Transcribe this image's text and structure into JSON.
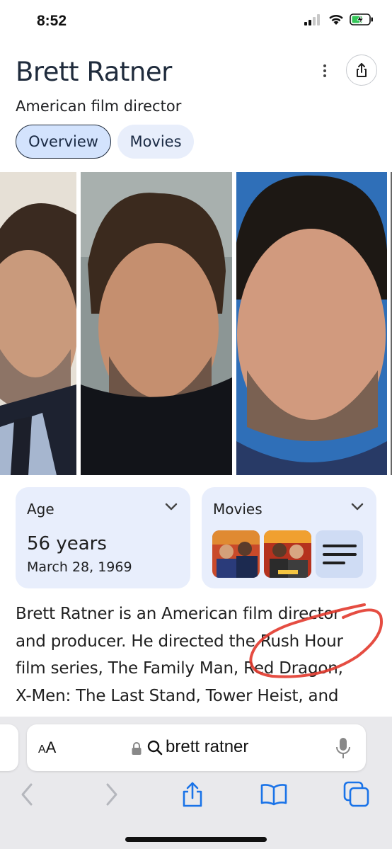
{
  "status": {
    "time": "8:52"
  },
  "header": {
    "title": "Brett Ratner",
    "subtitle": "American film director"
  },
  "tabs": [
    {
      "label": "Overview",
      "selected": true
    },
    {
      "label": "Movies",
      "selected": false
    }
  ],
  "age_card": {
    "title": "Age",
    "value": "56 years",
    "date": "March 28, 1969"
  },
  "movies_card": {
    "title": "Movies"
  },
  "description": {
    "lines": [
      "Brett Ratner is an American film director",
      "and producer. He directed the Rush Hour",
      "film series, The Family Man, Red Dragon,",
      "X-Men: The Last Stand, Tower Heist, and"
    ]
  },
  "browser": {
    "text_size_small": "A",
    "text_size_large": "A",
    "url": "brett ratner"
  },
  "colors": {
    "accent_chip": "#d3e3fd",
    "card_bg": "#e8eefc",
    "safari_blue": "#1a73e8",
    "annotation_red": "#e23a2e"
  },
  "icons": [
    "battery-charging-icon",
    "wifi-icon",
    "signal-icon",
    "more-vert-icon",
    "share-icon",
    "chevron-down-icon",
    "lock-icon",
    "search-icon",
    "mic-icon",
    "back-icon",
    "forward-icon",
    "bookmarks-icon",
    "tabs-icon"
  ]
}
